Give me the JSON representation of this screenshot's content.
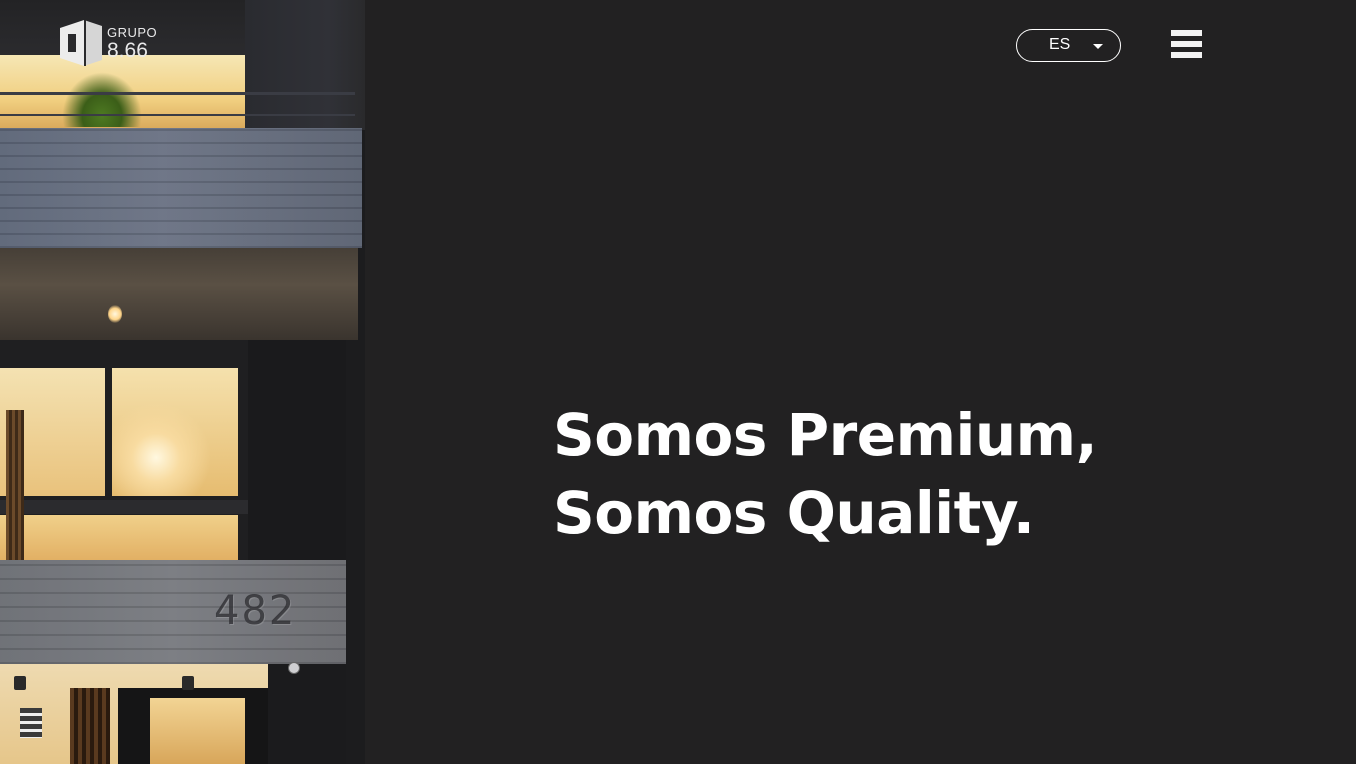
{
  "brand": {
    "logo_line1": "GRUPO",
    "logo_line2": "8.66",
    "logo_icon": "grupo-866-logo"
  },
  "header": {
    "language": {
      "selected": "ES",
      "caret_icon": "caret-down-icon"
    },
    "menu_icon": "hamburger-menu-icon"
  },
  "hero": {
    "line1": "Somos Premium,",
    "line2": "Somos Quality."
  },
  "photo": {
    "house_number": "482"
  },
  "colors": {
    "background": "#222122",
    "text": "#ffffff"
  }
}
